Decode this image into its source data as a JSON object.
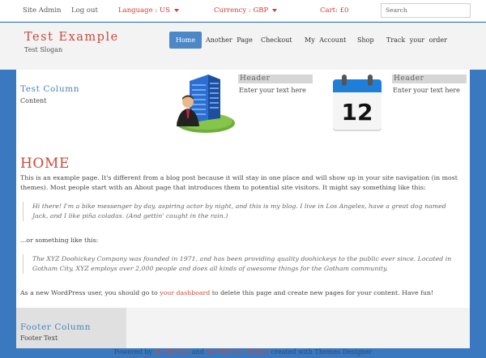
{
  "topbar": {
    "site_admin": "Site  Admin",
    "log_out": "Log out",
    "language": "Language : US",
    "currency": "Currency : GBP",
    "cart": "Cart: £0",
    "search_placeholder": "Search"
  },
  "header": {
    "site_title": "Test Example",
    "slogan": "Test Slogan"
  },
  "nav": {
    "items": [
      "Home",
      "Another  Page",
      "Checkout",
      "My  Account",
      "Shop",
      "Track  your  order"
    ]
  },
  "sidebar": {
    "title": "Test Column",
    "text": "Content"
  },
  "features": [
    {
      "title": "Header",
      "text": "Enter your text here",
      "icon": "office-building-icon"
    },
    {
      "title": "Header",
      "text": "Enter your text here",
      "icon": "calendar-icon",
      "calendar_day": "12"
    }
  ],
  "page": {
    "title": "HOME",
    "intro": "This is an example page. It's different from a blog post because it will stay in one place and will show up in your site navigation (in most themes). Most people start with an About page that introduces them to potential site visitors. It might say something like this:",
    "quote1": "Hi there! I'm a bike messenger by day, aspiring actor by night, and this is my blog. I live in Los Angeles, have a great dog named Jack, and I like piña coladas. (And gettin' caught in the rain.)",
    "or_text": "...or something like this:",
    "quote2": "The XYZ Doohickey Company was founded in 1971, and has been providing quality doohickeys to the public ever since. Located in Gotham City, XYZ employs over 2,000 people and does all kinds of awesome things for the Gotham community.",
    "outro_before": "As a new WordPress user, you should go to ",
    "outro_link": "your dashboard",
    "outro_after": " to delete this page and create new pages for your content. Have fun!"
  },
  "footer": {
    "title": "Footer Column",
    "text": "Footer Text",
    "powered_prefix": "Powered by ",
    "powered_link1": "WordPress",
    "powered_mid": " and ",
    "powered_link2": "WordPress Themes",
    "powered_suffix": " created with Themes Designer"
  },
  "colors": {
    "background": "#3a78bf",
    "accent_red": "#c84a3c",
    "accent_blue": "#4a82be",
    "nav_active": "#4d87c7"
  }
}
